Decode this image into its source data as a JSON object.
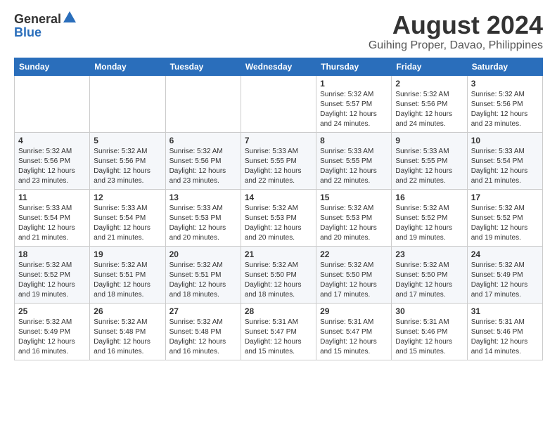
{
  "header": {
    "logo_general": "General",
    "logo_blue": "Blue",
    "month_title": "August 2024",
    "location": "Guihing Proper, Davao, Philippines"
  },
  "weekdays": [
    "Sunday",
    "Monday",
    "Tuesday",
    "Wednesday",
    "Thursday",
    "Friday",
    "Saturday"
  ],
  "weeks": [
    [
      {
        "day": "",
        "info": ""
      },
      {
        "day": "",
        "info": ""
      },
      {
        "day": "",
        "info": ""
      },
      {
        "day": "",
        "info": ""
      },
      {
        "day": "1",
        "info": "Sunrise: 5:32 AM\nSunset: 5:57 PM\nDaylight: 12 hours\nand 24 minutes."
      },
      {
        "day": "2",
        "info": "Sunrise: 5:32 AM\nSunset: 5:56 PM\nDaylight: 12 hours\nand 24 minutes."
      },
      {
        "day": "3",
        "info": "Sunrise: 5:32 AM\nSunset: 5:56 PM\nDaylight: 12 hours\nand 23 minutes."
      }
    ],
    [
      {
        "day": "4",
        "info": "Sunrise: 5:32 AM\nSunset: 5:56 PM\nDaylight: 12 hours\nand 23 minutes."
      },
      {
        "day": "5",
        "info": "Sunrise: 5:32 AM\nSunset: 5:56 PM\nDaylight: 12 hours\nand 23 minutes."
      },
      {
        "day": "6",
        "info": "Sunrise: 5:32 AM\nSunset: 5:56 PM\nDaylight: 12 hours\nand 23 minutes."
      },
      {
        "day": "7",
        "info": "Sunrise: 5:33 AM\nSunset: 5:55 PM\nDaylight: 12 hours\nand 22 minutes."
      },
      {
        "day": "8",
        "info": "Sunrise: 5:33 AM\nSunset: 5:55 PM\nDaylight: 12 hours\nand 22 minutes."
      },
      {
        "day": "9",
        "info": "Sunrise: 5:33 AM\nSunset: 5:55 PM\nDaylight: 12 hours\nand 22 minutes."
      },
      {
        "day": "10",
        "info": "Sunrise: 5:33 AM\nSunset: 5:54 PM\nDaylight: 12 hours\nand 21 minutes."
      }
    ],
    [
      {
        "day": "11",
        "info": "Sunrise: 5:33 AM\nSunset: 5:54 PM\nDaylight: 12 hours\nand 21 minutes."
      },
      {
        "day": "12",
        "info": "Sunrise: 5:33 AM\nSunset: 5:54 PM\nDaylight: 12 hours\nand 21 minutes."
      },
      {
        "day": "13",
        "info": "Sunrise: 5:33 AM\nSunset: 5:53 PM\nDaylight: 12 hours\nand 20 minutes."
      },
      {
        "day": "14",
        "info": "Sunrise: 5:32 AM\nSunset: 5:53 PM\nDaylight: 12 hours\nand 20 minutes."
      },
      {
        "day": "15",
        "info": "Sunrise: 5:32 AM\nSunset: 5:53 PM\nDaylight: 12 hours\nand 20 minutes."
      },
      {
        "day": "16",
        "info": "Sunrise: 5:32 AM\nSunset: 5:52 PM\nDaylight: 12 hours\nand 19 minutes."
      },
      {
        "day": "17",
        "info": "Sunrise: 5:32 AM\nSunset: 5:52 PM\nDaylight: 12 hours\nand 19 minutes."
      }
    ],
    [
      {
        "day": "18",
        "info": "Sunrise: 5:32 AM\nSunset: 5:52 PM\nDaylight: 12 hours\nand 19 minutes."
      },
      {
        "day": "19",
        "info": "Sunrise: 5:32 AM\nSunset: 5:51 PM\nDaylight: 12 hours\nand 18 minutes."
      },
      {
        "day": "20",
        "info": "Sunrise: 5:32 AM\nSunset: 5:51 PM\nDaylight: 12 hours\nand 18 minutes."
      },
      {
        "day": "21",
        "info": "Sunrise: 5:32 AM\nSunset: 5:50 PM\nDaylight: 12 hours\nand 18 minutes."
      },
      {
        "day": "22",
        "info": "Sunrise: 5:32 AM\nSunset: 5:50 PM\nDaylight: 12 hours\nand 17 minutes."
      },
      {
        "day": "23",
        "info": "Sunrise: 5:32 AM\nSunset: 5:50 PM\nDaylight: 12 hours\nand 17 minutes."
      },
      {
        "day": "24",
        "info": "Sunrise: 5:32 AM\nSunset: 5:49 PM\nDaylight: 12 hours\nand 17 minutes."
      }
    ],
    [
      {
        "day": "25",
        "info": "Sunrise: 5:32 AM\nSunset: 5:49 PM\nDaylight: 12 hours\nand 16 minutes."
      },
      {
        "day": "26",
        "info": "Sunrise: 5:32 AM\nSunset: 5:48 PM\nDaylight: 12 hours\nand 16 minutes."
      },
      {
        "day": "27",
        "info": "Sunrise: 5:32 AM\nSunset: 5:48 PM\nDaylight: 12 hours\nand 16 minutes."
      },
      {
        "day": "28",
        "info": "Sunrise: 5:31 AM\nSunset: 5:47 PM\nDaylight: 12 hours\nand 15 minutes."
      },
      {
        "day": "29",
        "info": "Sunrise: 5:31 AM\nSunset: 5:47 PM\nDaylight: 12 hours\nand 15 minutes."
      },
      {
        "day": "30",
        "info": "Sunrise: 5:31 AM\nSunset: 5:46 PM\nDaylight: 12 hours\nand 15 minutes."
      },
      {
        "day": "31",
        "info": "Sunrise: 5:31 AM\nSunset: 5:46 PM\nDaylight: 12 hours\nand 14 minutes."
      }
    ]
  ]
}
